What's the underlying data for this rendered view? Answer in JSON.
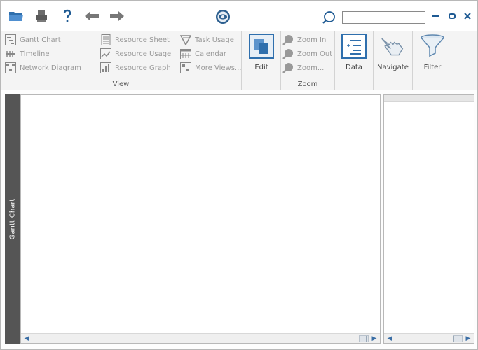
{
  "search": {
    "value": "",
    "placeholder": ""
  },
  "ribbon": {
    "view": {
      "label": "View",
      "col1": [
        "Gantt Chart",
        "Timeline",
        "Network Diagram"
      ],
      "col2": [
        "Resource Sheet",
        "Resource Usage",
        "Resource Graph"
      ],
      "col3": [
        "Task Usage",
        "Calendar",
        "More Views..."
      ]
    },
    "edit": {
      "label": "Edit"
    },
    "zoom": {
      "label": "Zoom",
      "items": [
        "Zoom In",
        "Zoom Out",
        "Zoom..."
      ]
    },
    "data": {
      "label": "Data"
    },
    "navigate": {
      "label": "Navigate"
    },
    "filter": {
      "label": "Filter"
    }
  },
  "side": {
    "label": "Gantt Chart"
  },
  "colors": {
    "accent": "#1e5a93",
    "disabled": "#999999",
    "strip": "#555555"
  },
  "icons": [
    "open-folder-icon",
    "print-icon",
    "help-icon",
    "back-arrow-icon",
    "forward-arrow-icon",
    "app-eye-icon",
    "search-icon",
    "minimize-icon",
    "restore-icon",
    "close-icon"
  ]
}
